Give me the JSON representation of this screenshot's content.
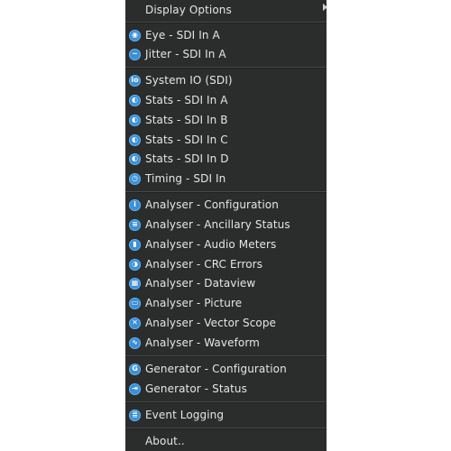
{
  "menu": {
    "display_options": "Display Options",
    "eye": "Eye - SDI In A",
    "jitter": "Jitter - SDI In A",
    "system_io": "System IO (SDI)",
    "stats_a": "Stats - SDI In A",
    "stats_b": "Stats - SDI In B",
    "stats_c": "Stats - SDI In C",
    "stats_d": "Stats - SDI In D",
    "timing": "Timing - SDI In",
    "an_config": "Analyser - Configuration",
    "an_ancillary": "Analyser - Ancillary Status",
    "an_audio": "Analyser - Audio Meters",
    "an_crc": "Analyser - CRC Errors",
    "an_dataview": "Analyser - Dataview",
    "an_picture": "Analyser - Picture",
    "an_vector": "Analyser - Vector Scope",
    "an_waveform": "Analyser - Waveform",
    "gen_config": "Generator - Configuration",
    "gen_status": "Generator - Status",
    "event_logging": "Event Logging",
    "about": "About.."
  },
  "icons": {
    "eye": "eye-icon",
    "jitter": "jitter-icon",
    "system_io": "system-io-icon",
    "stats": "stats-icon",
    "timing": "clock-icon",
    "config": "info-icon",
    "ancillary": "ancillary-icon",
    "audio": "audio-meter-icon",
    "crc": "crc-icon",
    "dataview": "grid-icon",
    "picture": "picture-icon",
    "vector": "vector-scope-icon",
    "waveform": "waveform-icon",
    "gen_config": "generator-config-icon",
    "gen_status": "generator-status-icon",
    "log": "log-icon"
  },
  "colors": {
    "menu_bg": "#2b2c2c",
    "text": "#e6e6e6",
    "icon_blue": "#3a8fd6"
  }
}
